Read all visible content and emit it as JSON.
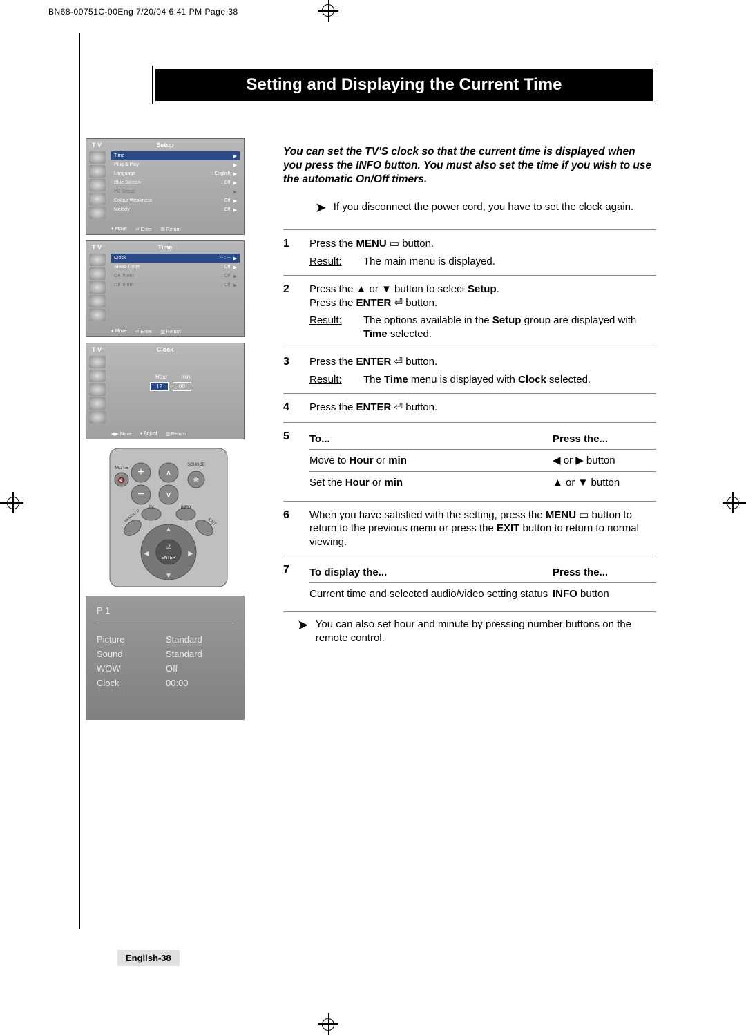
{
  "header": "BN68-00751C-00Eng  7/20/04 6:41 PM  Page 38",
  "title": "Setting and Displaying the Current Time",
  "intro": "You can set the TV'S clock so that the current time is displayed when you press the INFO button. You must also set the time if you wish to use the automatic On/Off timers.",
  "note1": "If you disconnect the power cord, you have to set the clock again.",
  "osd1": {
    "tv": "T V",
    "title": "Setup",
    "rows": [
      {
        "label": "Time",
        "val": "",
        "sel": true
      },
      {
        "label": "Plug & Play",
        "val": ""
      },
      {
        "label": "Language",
        "val": "English"
      },
      {
        "label": "Blue Screen",
        "val": "Off"
      },
      {
        "label": "PC Setup",
        "val": "",
        "dim": true
      },
      {
        "label": "Colour Weakness",
        "val": "Off"
      },
      {
        "label": "Melody",
        "val": "Off"
      }
    ],
    "footer": {
      "move": "Move",
      "enter": "Enter",
      "return": "Return"
    }
  },
  "osd2": {
    "tv": "T V",
    "title": "Time",
    "rows": [
      {
        "label": "Clock",
        "val": "-- : --",
        "sel": true
      },
      {
        "label": "Sleep Timer",
        "val": "Off"
      },
      {
        "label": "On Timer",
        "val": "Off",
        "dim": true
      },
      {
        "label": "Off Timer",
        "val": "Off",
        "dim": true
      }
    ],
    "footer": {
      "move": "Move",
      "enter": "Enter",
      "return": "Return"
    }
  },
  "osd3": {
    "tv": "T V",
    "title": "Clock",
    "hour_lbl": "Hour",
    "min_lbl": "min",
    "hour": "12",
    "min": "00",
    "footer": {
      "move": "Move",
      "adjust": "Adjust",
      "return": "Return"
    }
  },
  "info": {
    "p": "P  1",
    "rows": [
      {
        "l": "Picture",
        "v": "Standard"
      },
      {
        "l": "Sound",
        "v": "Standard"
      },
      {
        "l": "WOW",
        "v": "Off"
      },
      {
        "l": "Clock",
        "v": "00:00"
      }
    ]
  },
  "steps": {
    "s1": {
      "num": "1",
      "text_a": "Press the ",
      "text_b": "MENU",
      "text_c": " button.",
      "result": "The main menu is displayed."
    },
    "s2": {
      "num": "2",
      "line1_a": "Press the ▲ or ▼ button to select ",
      "line1_b": "Setup",
      "line1_c": ".",
      "line2_a": "Press the ",
      "line2_b": "ENTER",
      "line2_c": " button.",
      "result_a": "The options available in the ",
      "result_b": "Setup",
      "result_c": " group are displayed with ",
      "result_d": "Time",
      "result_e": " selected."
    },
    "s3": {
      "num": "3",
      "text_a": "Press the ",
      "text_b": "ENTER",
      "text_c": " button.",
      "result_a": "The ",
      "result_b": "Time",
      "result_c": " menu is displayed with ",
      "result_d": "Clock",
      "result_e": " selected."
    },
    "s4": {
      "num": "4",
      "text_a": "Press the ",
      "text_b": "ENTER",
      "text_c": " button."
    },
    "s5": {
      "num": "5",
      "to": "To...",
      "press": "Press the...",
      "r1_a": "Move to ",
      "r1_b": "Hour",
      "r1_c": " or ",
      "r1_d": "min",
      "r1_btn": "◀ or ▶ button",
      "r2_a": "Set the ",
      "r2_b": "Hour",
      "r2_c": " or ",
      "r2_d": "min",
      "r2_btn": "▲ or ▼ button"
    },
    "s6": {
      "num": "6",
      "text_a": "When you have satisfied with the setting, press the ",
      "text_b": "MENU",
      "text_c": " button to return to the previous menu or press the ",
      "text_d": "EXIT",
      "text_e": " button to return to normal viewing."
    },
    "s7": {
      "num": "7",
      "to": "To display the...",
      "press": "Press the...",
      "r1": "Current time and selected audio/video setting status",
      "r1_btn_a": "INFO",
      "r1_btn_b": " button"
    }
  },
  "note2": "You can also set hour and minute by pressing number buttons on the remote control.",
  "result_label": "Result",
  "footer_tag": "English-38",
  "remote_labels": {
    "mute": "MUTE",
    "source": "SOURCE",
    "tv": "TV",
    "info": "INFO",
    "menu": "MENU/LCD",
    "exit": "EXIT",
    "enter": "ENTER"
  }
}
